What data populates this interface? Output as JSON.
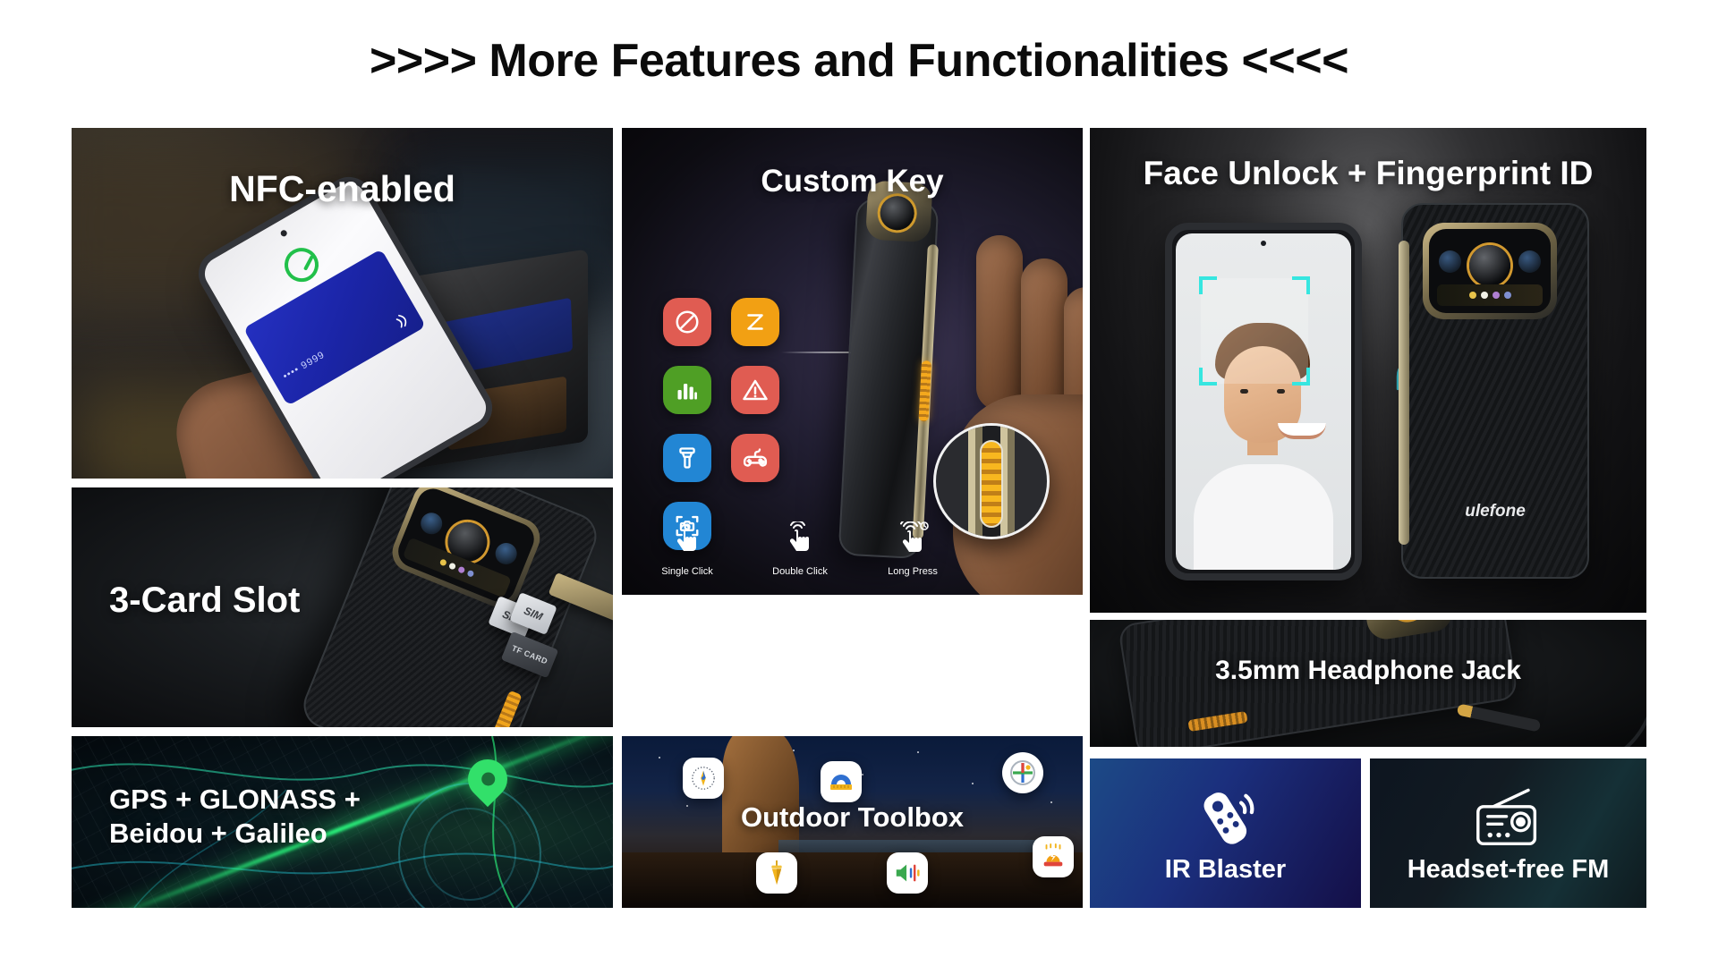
{
  "header": {
    "title": ">>>> More Features and Functionalities <<<<"
  },
  "panels": {
    "nfc": {
      "caption": "NFC-enabled",
      "card_digits": "•••• 9999"
    },
    "card_slot": {
      "caption": "3-Card Slot",
      "sim1_label": "SIM",
      "sim2_label": "SIM",
      "tf_label": "TF CARD"
    },
    "gps": {
      "caption": "GPS + GLONASS +\nBeidou + Galileo"
    },
    "custom_key": {
      "caption": "Custom Key",
      "icons": [
        {
          "name": "do-not-disturb-icon",
          "color": "#e05c52",
          "glyph": "block"
        },
        {
          "name": "sleep-mode-icon",
          "color": "#f2a013",
          "glyph": "zzz"
        },
        {
          "name": "bar-chart-icon",
          "color": "#4f9f25",
          "glyph": "chart"
        },
        {
          "name": "warning-icon",
          "color": "#e05c52",
          "glyph": "warning"
        },
        {
          "name": "flashlight-icon",
          "color": "#2286d4",
          "glyph": "flashlight"
        },
        {
          "name": "game-controller-icon",
          "color": "#e05c52",
          "glyph": "gamepad"
        },
        {
          "name": "camera-scan-icon",
          "color": "#2286d4",
          "glyph": "camera"
        }
      ],
      "gestures": [
        {
          "name": "single-click",
          "label": "Single Click"
        },
        {
          "name": "double-click",
          "label": "Double Click"
        },
        {
          "name": "long-press",
          "label": "Long Press"
        }
      ]
    },
    "outdoor": {
      "caption": "Outdoor Toolbox",
      "tools": [
        {
          "name": "compass-icon",
          "pos": "tl"
        },
        {
          "name": "protractor-icon",
          "pos": "tc"
        },
        {
          "name": "level-cross-icon",
          "pos": "tr"
        },
        {
          "name": "plumb-bob-icon",
          "pos": "bl"
        },
        {
          "name": "sound-meter-icon",
          "pos": "bc"
        },
        {
          "name": "alarm-siren-icon",
          "pos": "br"
        }
      ]
    },
    "face_unlock": {
      "caption": "Face Unlock + Fingerprint ID",
      "brand": "ulefone"
    },
    "headphone": {
      "caption": "3.5mm Headphone Jack"
    },
    "ir_blaster": {
      "caption": "IR Blaster"
    },
    "fm_radio": {
      "caption": "Headset-free FM"
    }
  },
  "colors": {
    "page_background": "#ffffff",
    "title_text": "#0b0b0b",
    "caption_text": "#ffffff",
    "accent_orange": "#f4a81d",
    "accent_green": "#32e06a",
    "ir_tile_gradient_start": "#1c4a86",
    "ir_tile_gradient_end": "#140f47",
    "fm_tile_gradient_start": "#0d1520",
    "fm_tile_gradient_end": "#153036"
  }
}
